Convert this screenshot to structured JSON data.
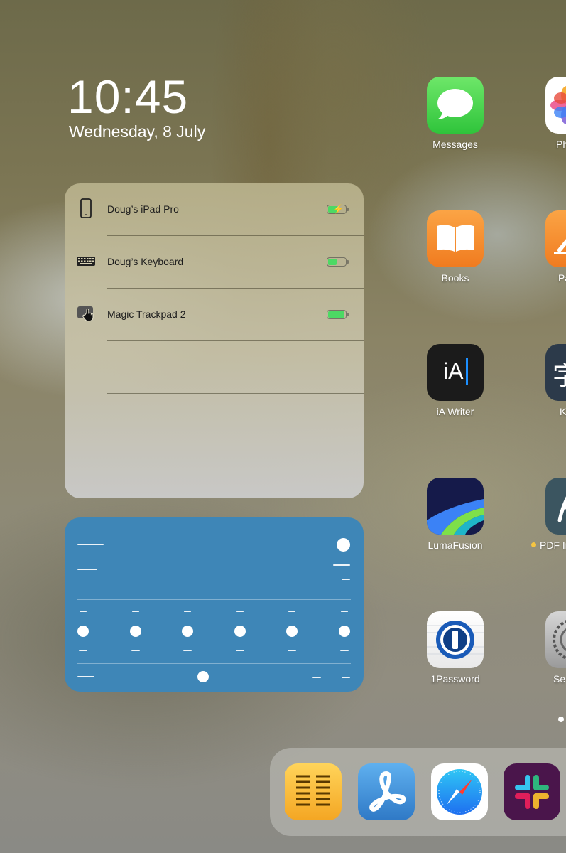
{
  "lock": {
    "time": "10:45",
    "date": "Wednesday, 8 July"
  },
  "batteries_widget": {
    "devices": [
      {
        "name": "Doug’s iPad Pro",
        "icon": "ipad-icon",
        "level": 0.55,
        "charging": true
      },
      {
        "name": "Doug’s Keyboard",
        "icon": "keyboard-icon",
        "level": 0.45,
        "charging": false
      },
      {
        "name": "Magic Trackpad 2",
        "icon": "trackpad-icon",
        "level": 0.9,
        "charging": false
      }
    ],
    "colors": {
      "battery_fill": "#4cd964"
    }
  },
  "blue_widget": {
    "color": "#3e86b7"
  },
  "home": {
    "apps": [
      {
        "label": "Messages",
        "icon": "messages-icon"
      },
      {
        "label": "Books",
        "icon": "books-icon"
      },
      {
        "label": "iA Writer",
        "icon": "ia-writer-icon",
        "glyph": "iA"
      },
      {
        "label": "LumaFusion",
        "icon": "lumafusion-icon"
      },
      {
        "label": "1Password",
        "icon": "onepassword-icon"
      }
    ],
    "partial_right_labels": [
      "Ph",
      "Pa",
      "K",
      "PDF In",
      "Se"
    ],
    "dock": [
      "notes-list-icon",
      "pdf-expert-icon",
      "safari-icon",
      "slack-icon"
    ]
  }
}
